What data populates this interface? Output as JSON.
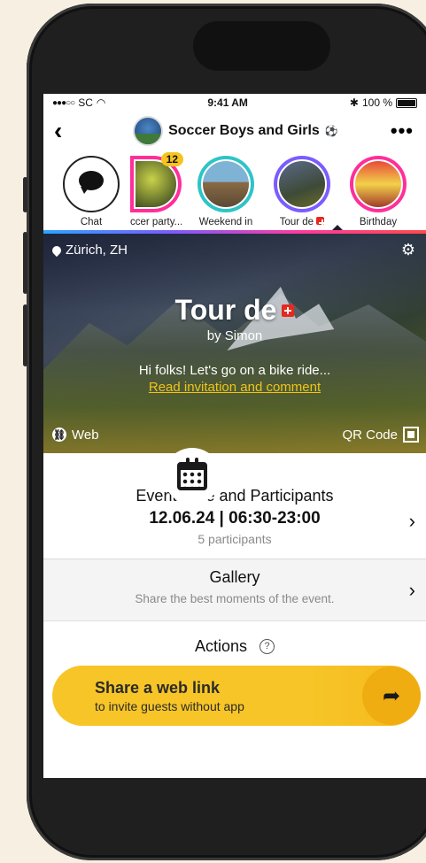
{
  "status_bar": {
    "carrier": "SC",
    "time": "9:41 AM",
    "battery": "100 %"
  },
  "header": {
    "title": "Soccer Boys and Girls"
  },
  "stories": [
    {
      "label": "Chat",
      "type": "chat"
    },
    {
      "label": "ccer party...",
      "badge": "12",
      "ring": "#ff2e9a",
      "fill": "#3a5a2a"
    },
    {
      "label": "Weekend in",
      "ring": "#2ec4c7",
      "fill": "#7a6b4c"
    },
    {
      "label": "Tour de",
      "ring": "#7a5cff",
      "fill": "#4d5b7a",
      "flag": true,
      "active": true
    },
    {
      "label": "Birthday",
      "ring": "#ff2e9a",
      "fill": "#a33a2c"
    }
  ],
  "hero": {
    "location": "Zürich, ZH",
    "title": "Tour de",
    "by": "by Simon",
    "description": "Hi folks! Let's go on a bike ride...",
    "read_link": "Read invitation and comment",
    "web_label": "Web",
    "qr_label": "QR Code"
  },
  "event_date": {
    "title": "Event Date and Participants",
    "date": "12.06.24 | 06:30-23:00",
    "participants": "5 participants"
  },
  "gallery": {
    "title": "Gallery",
    "subtitle": "Share the best moments of the event."
  },
  "actions": {
    "title": "Actions"
  },
  "share": {
    "title": "Share a web link",
    "subtitle": "to invite guests without app"
  },
  "colors": {
    "accent": "#f7c527",
    "link": "#f0c419"
  }
}
